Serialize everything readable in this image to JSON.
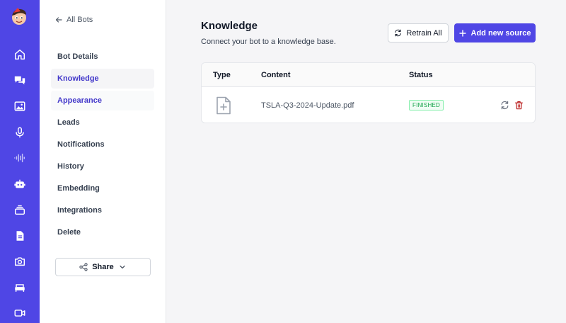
{
  "rail": {
    "icons": [
      "app-logo",
      "home-icon",
      "chat-icon",
      "image-icon",
      "mic-icon",
      "waveform-icon",
      "bot-icon",
      "layers-icon",
      "document-icon",
      "camera-icon",
      "sofa-icon",
      "video-icon"
    ]
  },
  "nav": {
    "back_label": "All Bots",
    "items": [
      {
        "label": "Bot Details",
        "state": ""
      },
      {
        "label": "Knowledge",
        "state": "active"
      },
      {
        "label": "Appearance",
        "state": "hover"
      },
      {
        "label": "Leads",
        "state": ""
      },
      {
        "label": "Notifications",
        "state": ""
      },
      {
        "label": "History",
        "state": ""
      },
      {
        "label": "Embedding",
        "state": ""
      },
      {
        "label": "Integrations",
        "state": ""
      },
      {
        "label": "Delete",
        "state": ""
      }
    ],
    "share_label": "Share"
  },
  "main": {
    "title": "Knowledge",
    "subtitle": "Connect your bot to a knowledge base.",
    "retrain_label": "Retrain All",
    "add_label": "Add new source",
    "table": {
      "headers": [
        "Type",
        "Content",
        "Status"
      ],
      "rows": [
        {
          "type_icon": "file-plus-icon",
          "content": "TSLA-Q3-2024-Update.pdf",
          "status": "FINISHED"
        }
      ]
    }
  },
  "colors": {
    "accent": "#4f46e5",
    "success": "#16a34a",
    "danger": "#b91c1c"
  }
}
